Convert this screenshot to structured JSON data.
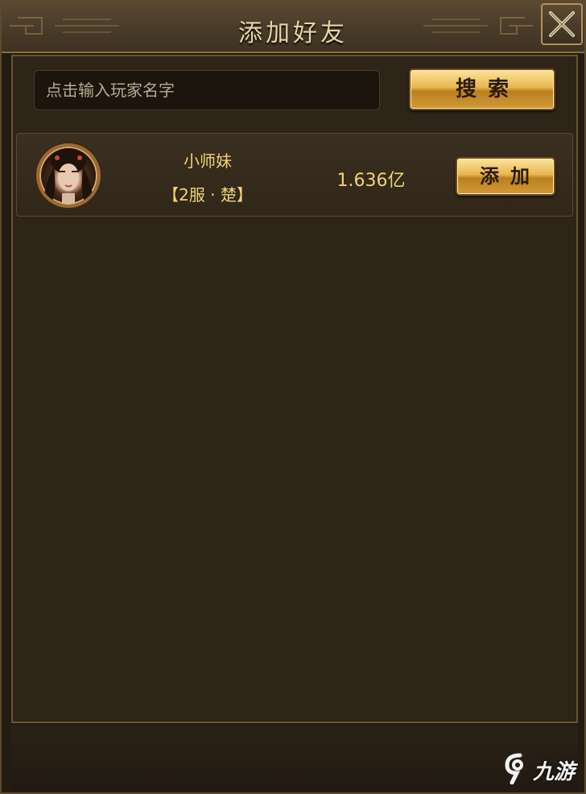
{
  "dialog": {
    "title": "添加好友",
    "close_icon": "close-x-icon"
  },
  "search": {
    "placeholder": "点击输入玩家名字",
    "value": "",
    "button_label": "搜索"
  },
  "results": [
    {
      "name": "小师妹",
      "server": "【2服 · 楚】",
      "power": "1.636亿",
      "add_label": "添加",
      "avatar_icon": "player-portrait-avatar"
    }
  ],
  "colors": {
    "gold_text": "#f0d27a",
    "title_text": "#e6d4a8",
    "panel_bg": "#2e2418",
    "button_gold": "#e8b54f"
  },
  "watermark": {
    "logo_icon": "9you-logo-icon",
    "text": "九游"
  }
}
